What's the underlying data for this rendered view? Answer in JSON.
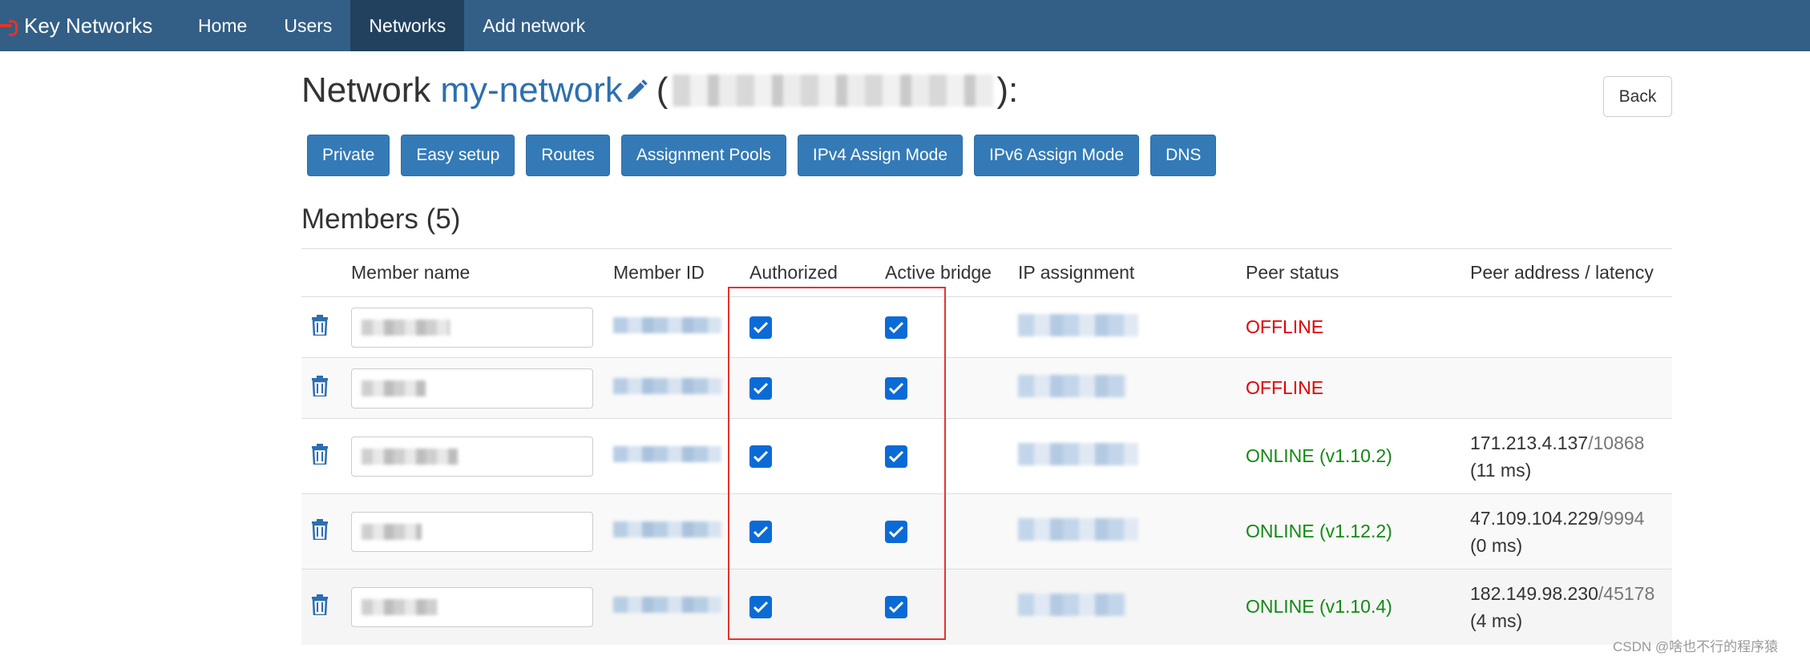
{
  "navbar": {
    "brand": "Key Networks",
    "items": [
      {
        "label": "Home",
        "active": false
      },
      {
        "label": "Users",
        "active": false
      },
      {
        "label": "Networks",
        "active": true
      },
      {
        "label": "Add network",
        "active": false
      }
    ]
  },
  "header": {
    "prefix": "Network",
    "network_name": "my-network",
    "id_open": "(",
    "id_close": "):",
    "back_label": "Back"
  },
  "actions": [
    "Private",
    "Easy setup",
    "Routes",
    "Assignment Pools",
    "IPv4 Assign Mode",
    "IPv6 Assign Mode",
    "DNS"
  ],
  "members": {
    "title": "Members (5)",
    "columns": [
      "Member name",
      "Member ID",
      "Authorized",
      "Active bridge",
      "IP assignment",
      "Peer status",
      "Peer address / latency"
    ],
    "rows": [
      {
        "authorized": true,
        "active_bridge": true,
        "status": "OFFLINE",
        "online": false,
        "peer_ip": "",
        "peer_port": "",
        "latency": ""
      },
      {
        "authorized": true,
        "active_bridge": true,
        "status": "OFFLINE",
        "online": false,
        "peer_ip": "",
        "peer_port": "",
        "latency": ""
      },
      {
        "authorized": true,
        "active_bridge": true,
        "status": "ONLINE (v1.10.2)",
        "online": true,
        "peer_ip": "171.213.4.137",
        "peer_port": "/10868",
        "latency": "(11 ms)"
      },
      {
        "authorized": true,
        "active_bridge": true,
        "status": "ONLINE (v1.12.2)",
        "online": true,
        "peer_ip": "47.109.104.229",
        "peer_port": "/9994",
        "latency": "(0 ms)"
      },
      {
        "authorized": true,
        "active_bridge": true,
        "status": "ONLINE (v1.10.4)",
        "online": true,
        "peer_ip": "182.149.98.230",
        "peer_port": "/45178",
        "latency": "(4 ms)"
      }
    ]
  },
  "watermark": "CSDN @啥也不行的程序猿",
  "colors": {
    "navbar": "#335e86",
    "nav_active": "#22415f",
    "button": "#337ab7",
    "offline": "#e00000",
    "online": "#128a12",
    "highlight": "#e3342f"
  }
}
